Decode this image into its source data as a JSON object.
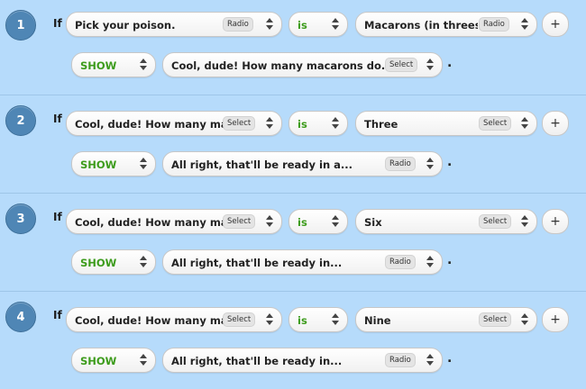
{
  "rules": [
    {
      "number": "1",
      "if_label": "If",
      "field": {
        "text": "Pick your poison.",
        "tag": "Radio"
      },
      "operator": "is",
      "value": {
        "text": "Macarons (in threes",
        "tag": "Radio"
      },
      "action": "SHOW",
      "target": {
        "text": "Cool, dude! How many macarons do...",
        "tag": "Select"
      },
      "period": "."
    },
    {
      "number": "2",
      "if_label": "If",
      "field": {
        "text": "Cool, dude! How many ma",
        "tag": "Select"
      },
      "operator": "is",
      "value": {
        "text": "Three",
        "tag": "Select"
      },
      "action": "SHOW",
      "target": {
        "text": "All right, that'll be ready in a...",
        "tag": "Radio"
      },
      "period": "."
    },
    {
      "number": "3",
      "if_label": "If",
      "field": {
        "text": "Cool, dude! How many ma",
        "tag": "Select"
      },
      "operator": "is",
      "value": {
        "text": "Six",
        "tag": "Select"
      },
      "action": "SHOW",
      "target": {
        "text": "All right, that'll be ready in...",
        "tag": "Radio"
      },
      "period": "."
    },
    {
      "number": "4",
      "if_label": "If",
      "field": {
        "text": "Cool, dude! How many ma",
        "tag": "Select"
      },
      "operator": "is",
      "value": {
        "text": "Nine",
        "tag": "Select"
      },
      "action": "SHOW",
      "target": {
        "text": "All right, that'll be ready in...",
        "tag": "Radio"
      },
      "period": "."
    }
  ],
  "add_label": "+",
  "colors": {
    "background": "#b6dbfb",
    "badge": "#4f86b5",
    "keyword_green": "#3d9c1c"
  }
}
